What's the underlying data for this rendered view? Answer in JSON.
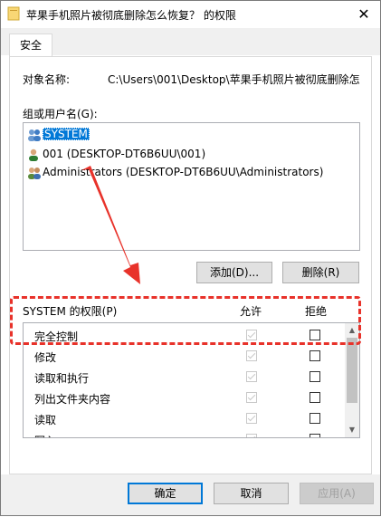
{
  "window": {
    "title": "苹果手机照片被彻底删除怎么恢复？ 的权限",
    "close_glyph": "✕"
  },
  "tabs": [
    {
      "label": "安全",
      "active": true
    }
  ],
  "object": {
    "label": "对象名称:",
    "value": "C:\\Users\\001\\Desktop\\苹果手机照片被彻底删除怎"
  },
  "users": {
    "label": "组或用户名(G):",
    "items": [
      {
        "name": "SYSTEM",
        "icon": "group-users-icon",
        "selected": true
      },
      {
        "name": "001 (DESKTOP-DT6B6UU\\001)",
        "icon": "single-user-icon",
        "selected": false
      },
      {
        "name": "Administrators (DESKTOP-DT6B6UU\\Administrators)",
        "icon": "group-users-icon",
        "selected": false
      }
    ]
  },
  "buttons": {
    "add": "添加(D)...",
    "remove": "删除(R)",
    "ok": "确定",
    "cancel": "取消",
    "apply": "应用(A)"
  },
  "permissions": {
    "header": "SYSTEM 的权限(P)",
    "allow_label": "允许",
    "deny_label": "拒绝",
    "rows": [
      {
        "name": "完全控制",
        "allow": true,
        "deny": false
      },
      {
        "name": "修改",
        "allow": true,
        "deny": false
      },
      {
        "name": "读取和执行",
        "allow": true,
        "deny": false
      },
      {
        "name": "列出文件夹内容",
        "allow": true,
        "deny": false
      },
      {
        "name": "读取",
        "allow": true,
        "deny": false
      },
      {
        "name": "写入",
        "allow": true,
        "deny": false
      }
    ]
  },
  "colors": {
    "selection": "#0078d7",
    "annotation": "#e8322a",
    "default_button_border": "#0078d7"
  }
}
